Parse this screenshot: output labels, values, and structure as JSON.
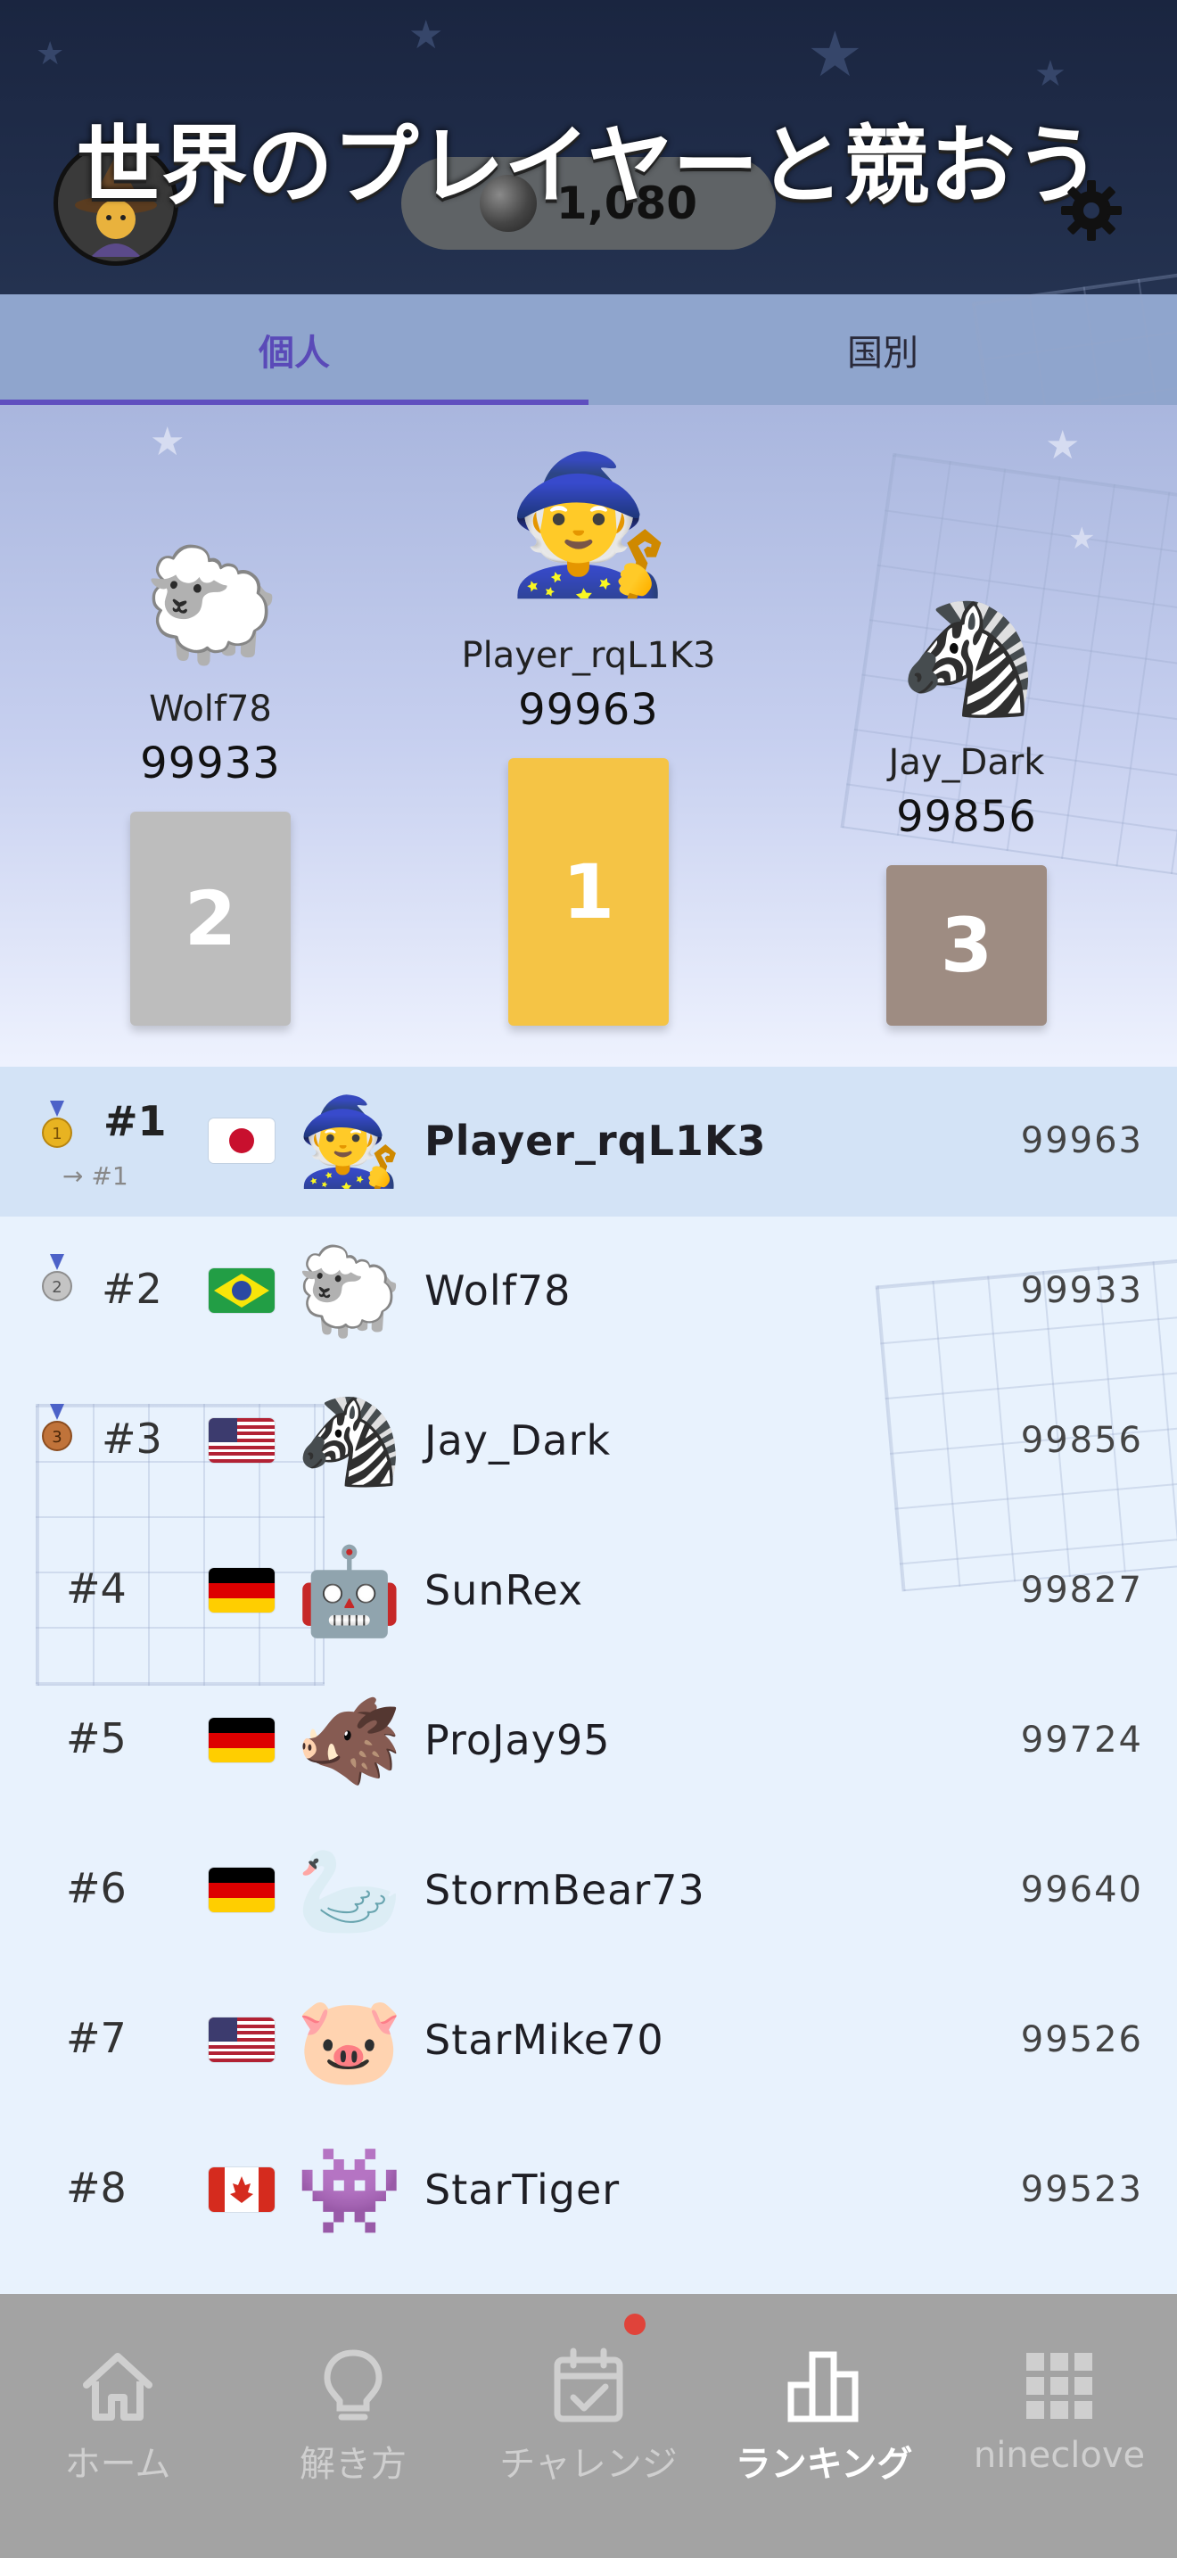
{
  "header": {
    "title": "世界のプレイヤーと競おう",
    "coins": "1,080",
    "avatar_icon": "mage-icon",
    "settings_icon": "gear-icon"
  },
  "tabs": [
    {
      "label": "個人",
      "active": true
    },
    {
      "label": "国別",
      "active": false
    }
  ],
  "podium": {
    "first": {
      "name": "Player_rqL1K3",
      "score": "99963",
      "place": "1",
      "icon": "🧙",
      "color": "#f5c445"
    },
    "second": {
      "name": "Wolf78",
      "score": "99933",
      "place": "2",
      "icon": "🐑",
      "color": "#bdbdbd"
    },
    "third": {
      "name": "Jay_Dark",
      "score": "99856",
      "place": "3",
      "icon": "🦓",
      "color": "#9e8c82"
    }
  },
  "leaderboard": [
    {
      "rank": "#1",
      "prev_rank": "→ #1",
      "flag": "JP",
      "icon": "🧙",
      "name": "Player_rqL1K3",
      "score": "99963",
      "medal": "gold",
      "me": true
    },
    {
      "rank": "#2",
      "flag": "BR",
      "icon": "🐑",
      "name": "Wolf78",
      "score": "99933",
      "medal": "silver"
    },
    {
      "rank": "#3",
      "flag": "US",
      "icon": "🦓",
      "name": "Jay_Dark",
      "score": "99856",
      "medal": "bronze"
    },
    {
      "rank": "#4",
      "flag": "DE",
      "icon": "🤖",
      "name": "SunRex",
      "score": "99827"
    },
    {
      "rank": "#5",
      "flag": "DE",
      "icon": "🐗",
      "name": "ProJay95",
      "score": "99724"
    },
    {
      "rank": "#6",
      "flag": "DE",
      "icon": "🦢",
      "name": "StormBear73",
      "score": "99640"
    },
    {
      "rank": "#7",
      "flag": "US",
      "icon": "🐷",
      "name": "StarMike70",
      "score": "99526"
    },
    {
      "rank": "#8",
      "flag": "CA",
      "icon": "👾",
      "name": "StarTiger",
      "score": "99523"
    }
  ],
  "nav": [
    {
      "label": "ホーム",
      "icon": "home-icon"
    },
    {
      "label": "解き方",
      "icon": "lightbulb-icon"
    },
    {
      "label": "チャレンジ",
      "icon": "calendar-check-icon",
      "badge": true
    },
    {
      "label": "ランキング",
      "icon": "bar-chart-icon",
      "active": true
    },
    {
      "label": "nineclove",
      "icon": "grid-icon"
    }
  ]
}
